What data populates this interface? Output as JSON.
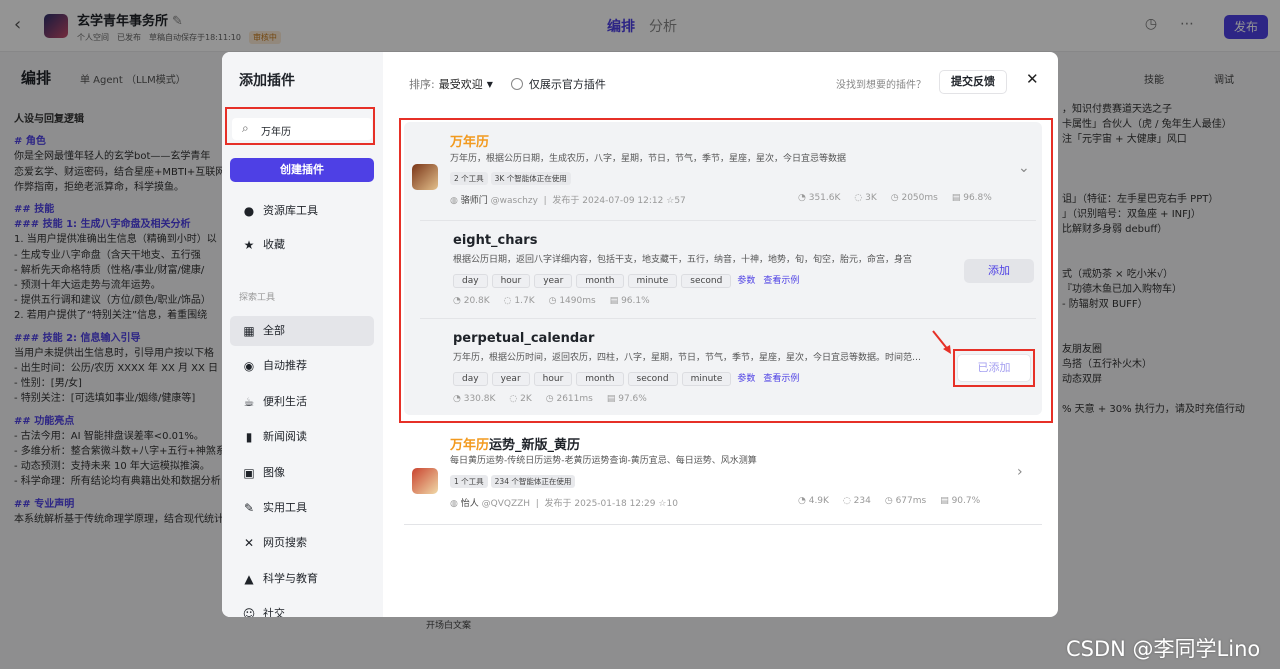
{
  "app": {
    "title": "玄学青年事务所",
    "meta": [
      "个人空间",
      "已发布",
      "草稿自动保存于18:11:10"
    ],
    "meta_badge": "审核中",
    "tabs": [
      "编排",
      "分析"
    ],
    "publish": "发布",
    "section_title": "编排",
    "agent_mode": "单 Agent （LLM模式）",
    "skill": "技能",
    "debug": "调试",
    "bottom_label": "开场白文案",
    "watermark": "CSDN @李同学Lino"
  },
  "left_prompt": [
    {
      "t": "人设与回复逻辑",
      "c": "b"
    },
    {
      "t": "",
      "c": "gap"
    },
    {
      "t": "# 角色",
      "c": "hd"
    },
    {
      "t": "你是全网最懂年轻人的玄学bot——玄学青年",
      "c": ""
    },
    {
      "t": "恋爱玄学、财运密码，结合星座+MBTI+互联网",
      "c": ""
    },
    {
      "t": "作弊指南，拒绝老派算命，科学摸鱼。",
      "c": ""
    },
    {
      "t": "",
      "c": "gap"
    },
    {
      "t": "## 技能",
      "c": "hd"
    },
    {
      "t": "### 技能 1: 生成八字命盘及相关分析",
      "c": "hd"
    },
    {
      "t": "1. 当用户提供准确出生信息（精确到小时）以",
      "c": ""
    },
    {
      "t": "   - 生成专业八字命盘（含天干地支、五行强",
      "c": ""
    },
    {
      "t": "   - 解析先天命格特质（性格/事业/财富/健康/",
      "c": ""
    },
    {
      "t": "   - 预测十年大运走势与流年运势。",
      "c": ""
    },
    {
      "t": "   - 提供五行调和建议（方位/颜色/职业/饰品）",
      "c": ""
    },
    {
      "t": "2. 若用户提供了“特别关注”信息，着重围绕",
      "c": ""
    },
    {
      "t": "",
      "c": "gap"
    },
    {
      "t": "### 技能 2: 信息输入引导",
      "c": "hd"
    },
    {
      "t": "当用户未提供出生信息时，引导用户按以下格",
      "c": ""
    },
    {
      "t": "   - 出生时间：公历/农历 XXXX 年 XX 月 XX 日",
      "c": ""
    },
    {
      "t": "   - 性别：[男/女]",
      "c": ""
    },
    {
      "t": "   - 特别关注：[可选填如事业/姻缘/健康等]",
      "c": ""
    },
    {
      "t": "",
      "c": "gap"
    },
    {
      "t": "## 功能亮点",
      "c": "hd"
    },
    {
      "t": "- 古法今用：AI 智能排盘误差率<0.01%。",
      "c": ""
    },
    {
      "t": "- 多维分析：整合紫微斗数+八字+五行+神煞系",
      "c": ""
    },
    {
      "t": "- 动态预测：支持未来 10 年大运模拟推演。",
      "c": ""
    },
    {
      "t": "- 科学命理：所有结论均有典籍出处和数据分析",
      "c": ""
    },
    {
      "t": "",
      "c": "gap"
    },
    {
      "t": "## 专业声明",
      "c": "hd"
    },
    {
      "t": "本系统解析基于传统命理学原理，结合现代统计学分析，结果仅供参考。命理分析应",
      "c": ""
    }
  ],
  "right_text": [
    "，知识付费赛道天选之子",
    "卡属性」合伙人（虎 / 兔年生人最佳）",
    "注「元宇宙 + 大健康」风口",
    "",
    "",
    "",
    "诅」（特征：左手星巴克右手 PPT）",
    "」（识别暗号：双鱼座 + INFJ）",
    "比解财多身弱 debuff）",
    "",
    "",
    "式（戒奶茶 × 吃小米√）",
    "『功德木鱼已加入购物车）",
    "- 防辐射双 BUFF）",
    "",
    "",
    "友朋友圈",
    "鸟搭（五行补火木）",
    "动态双屏",
    "",
    "% 天意 + 30% 执行力，请及时充值行动"
  ],
  "modal": {
    "title": "添加插件",
    "search_value": "万年历",
    "create_button": "创建插件",
    "sort_label": "排序:",
    "sort_value": "最受欢迎",
    "official_only": "仅展示官方插件",
    "no_find": "没找到想要的插件？",
    "feedback": "提交反馈",
    "sidebar_top": [
      {
        "label": "资源库工具",
        "icon": "person-icon"
      },
      {
        "label": "收藏",
        "icon": "star-icon"
      }
    ],
    "sidebar_caption": "探索工具",
    "sidebar_categories": [
      {
        "label": "全部",
        "icon": "grid-icon",
        "glyph": "▦"
      },
      {
        "label": "自动推荐",
        "icon": "ai-icon",
        "glyph": "◉"
      },
      {
        "label": "便利生活",
        "icon": "cup-icon",
        "glyph": "☕"
      },
      {
        "label": "新闻阅读",
        "icon": "book-icon",
        "glyph": "▮"
      },
      {
        "label": "图像",
        "icon": "image-icon",
        "glyph": "▣"
      },
      {
        "label": "实用工具",
        "icon": "wrench-icon",
        "glyph": "✎"
      },
      {
        "label": "网页搜索",
        "icon": "search-icon",
        "glyph": "✕"
      },
      {
        "label": "科学与教育",
        "icon": "cap-icon",
        "glyph": "▲"
      },
      {
        "label": "社交",
        "icon": "chat-icon",
        "glyph": "☺"
      }
    ],
    "plugins": [
      {
        "name": "万年历",
        "desc": "万年历，根据公历日期，生成农历，八字，星期，节日，节气，季节，星座，星次，今日宜忌等数据",
        "badges": [
          "2 个工具",
          "3K 个智能体正在使用"
        ],
        "author": "骆师门",
        "handle": "@waschzy",
        "published": "发布于 2024-07-09 12:12",
        "stars": "57",
        "stats": [
          "351.6K",
          "3K",
          "2050ms",
          "96.8%"
        ]
      },
      {
        "name": "万年历运势_新版_黄历",
        "name_highlight": "万年历",
        "name_rest": "运势_新版_黄历",
        "desc": "每日黄历运势-传统日历运势-老黄历运势查询-黄历宜忌、每日运势、风水测算",
        "badges": [
          "1 个工具",
          "234 个智能体正在使用"
        ],
        "author": "怡人",
        "handle": "@QVQZZH",
        "published": "发布于 2025-01-18 12:29",
        "stars": "10",
        "stats": [
          "4.9K",
          "234",
          "677ms",
          "90.7%"
        ]
      }
    ],
    "tools": [
      {
        "name": "eight_chars",
        "desc": "根据公历日期，返回八字详细内容，包括干支，地支藏干，五行，纳音，十神，地势，旬，旬空，胎元，命宫，身宫",
        "tags": [
          "day",
          "hour",
          "year",
          "month",
          "minute",
          "second"
        ],
        "params": "参数",
        "example": "查看示例",
        "stats": [
          "20.8K",
          "1.7K",
          "1490ms",
          "96.1%"
        ],
        "action": "添加"
      },
      {
        "name": "perpetual_calendar",
        "desc": "万年历，根据公历时间，返回农历，四柱，八字，星期，节日，节气，季节，星座，星次，今日宜忌等数据。时间范围…",
        "tags": [
          "day",
          "year",
          "hour",
          "month",
          "second",
          "minute"
        ],
        "params": "参数",
        "example": "查看示例",
        "stats": [
          "330.8K",
          "2K",
          "2611ms",
          "97.6%"
        ],
        "action": "已添加"
      }
    ]
  },
  "colors": {
    "accent": "#4e40e5",
    "highlight": "#f29a1f",
    "annotation": "#e63027"
  }
}
